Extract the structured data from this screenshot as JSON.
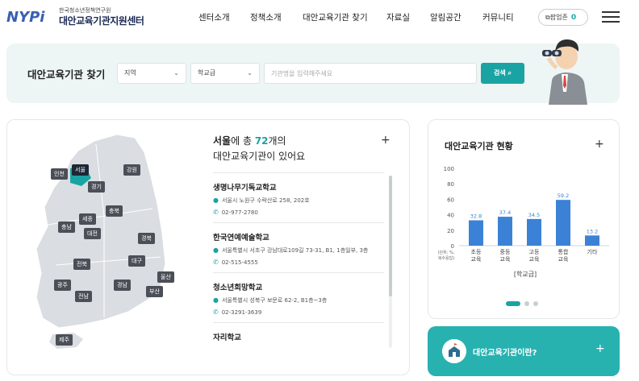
{
  "header": {
    "logo_mark": "NYPi",
    "logo_sub": "한국청소년정책연구원",
    "logo_main": "대안교육기관지원센터",
    "nav": [
      "센터소개",
      "정책소개",
      "대안교육기관 찾기",
      "자료실",
      "알림공간",
      "커뮤니티"
    ],
    "popup_label": "팝업존",
    "popup_count": "0"
  },
  "search": {
    "title": "대안교육기관 찾기",
    "region_select": "지역",
    "level_select": "학교급",
    "placeholder": "기관명을 입력해주세요",
    "button": "검색"
  },
  "map": {
    "regions": [
      "인천",
      "서울",
      "강원",
      "경기",
      "충북",
      "세종",
      "충남",
      "대전",
      "경북",
      "전북",
      "대구",
      "광주",
      "경남",
      "울산",
      "전남",
      "부산",
      "제주"
    ],
    "selected": "서울"
  },
  "list": {
    "head_pre": "서울",
    "head_mid": "에 총 ",
    "count": "72",
    "head_unit": "개의",
    "head_line2": "대안교육기관이 있어요",
    "schools": [
      {
        "name": "생명나무기독교학교",
        "address": "서울시 노원구 수락산로 258, 202호",
        "phone": "02-977-2780"
      },
      {
        "name": "한국연예예술학교",
        "address": "서울특별시 서초구 강남대로109길 73-31, B1, 1층일부, 3층",
        "phone": "02-515-4555"
      },
      {
        "name": "청소년희망학교",
        "address": "서울특별시 성북구 보문로 62-2, B1층~3층",
        "phone": "02-3291-3639"
      },
      {
        "name": "자리학교",
        "address": "",
        "phone": ""
      }
    ]
  },
  "chart_data": {
    "type": "bar",
    "title": "대안교육기관 현황",
    "categories": [
      "초등 교육",
      "중등 교육",
      "고등 교육",
      "통합 교육",
      "기타"
    ],
    "values": [
      32.8,
      37.4,
      34.5,
      59.2,
      13.2
    ],
    "ylim": [
      0,
      100
    ],
    "yticks": [
      0,
      20,
      40,
      60,
      80,
      100
    ],
    "unit_note": "(단위: %, 복수응답)",
    "xlabel": "[학교급]",
    "color": "#3b82d6"
  },
  "about": {
    "label": "대안교육기관이란?"
  },
  "colors": {
    "accent": "#1aa3a3",
    "about_bg": "#27b2b0",
    "map_fill": "#dadde1"
  }
}
